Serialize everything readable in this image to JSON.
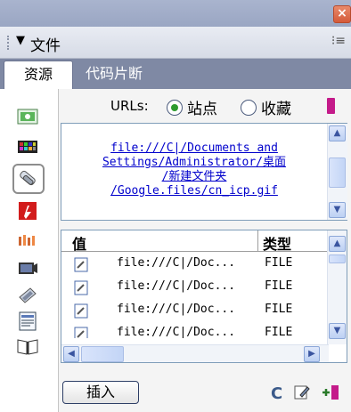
{
  "window": {
    "close_glyph": "×"
  },
  "panel": {
    "collapse_glyph": "▼",
    "title": "文件",
    "menu_icon": "list-menu-icon"
  },
  "tabs": [
    {
      "label": "资源",
      "active": true
    },
    {
      "label": "代码片断",
      "active": false
    }
  ],
  "toolbar": {
    "items": [
      {
        "icon": "image-icon"
      },
      {
        "icon": "colors-icon"
      },
      {
        "icon": "url-link-icon",
        "selected": true
      },
      {
        "icon": "flash-icon"
      },
      {
        "icon": "shockwave-icon"
      },
      {
        "icon": "movie-icon"
      },
      {
        "icon": "script-icon"
      },
      {
        "icon": "template-icon"
      },
      {
        "icon": "library-icon"
      }
    ]
  },
  "urls": {
    "label": "URLs:",
    "options": [
      {
        "label": "站点",
        "selected": true
      },
      {
        "label": "收藏",
        "selected": false
      }
    ]
  },
  "preview": {
    "lines": [
      "file:///C|/Documents and",
      "Settings/Administrator/桌面",
      "/新建文件夹",
      "/Google.files/cn_icp.gif"
    ]
  },
  "table": {
    "headers": {
      "value": "值",
      "type": "类型"
    },
    "rows": [
      {
        "value": "file:///C|/Doc...",
        "type": "FILE"
      },
      {
        "value": "file:///C|/Doc...",
        "type": "FILE"
      },
      {
        "value": "file:///C|/Doc...",
        "type": "FILE"
      },
      {
        "value": "file:///C|/Doc...",
        "type": "FILE"
      }
    ]
  },
  "bottom": {
    "insert_label": "插入",
    "refresh_glyph": "C"
  },
  "colors": {
    "link": "#0000cc",
    "accent_green": "#2e9b2e",
    "bookmark": "#c41b8a",
    "tab_strip": "#7f89a4"
  }
}
